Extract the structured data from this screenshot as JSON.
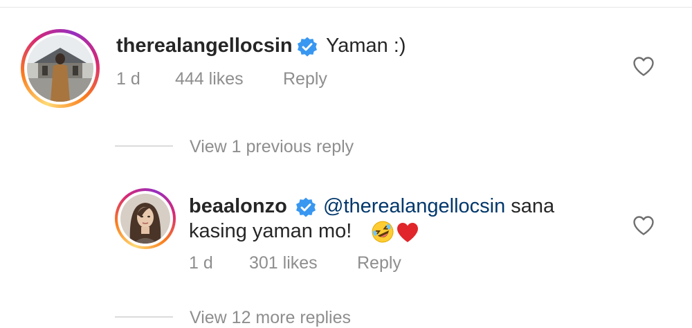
{
  "comments": [
    {
      "username": "therealangellocsin",
      "text": "Yaman :)",
      "time": "1 d",
      "likes": "444 likes",
      "reply_label": "Reply"
    },
    {
      "username": "beaalonzo",
      "mention": "@therealangellocsin",
      "text_line1": " sana",
      "text_line2": "kasing yaman mo!",
      "time": "1 d",
      "likes": "301 likes",
      "reply_label": "Reply"
    }
  ],
  "view_previous": "View 1 previous reply",
  "view_more": "View 12 more replies",
  "colors": {
    "text": "#262626",
    "secondary": "#8e8e8e",
    "mention": "#00376b",
    "verified": "#3897f0"
  },
  "icons": [
    "verified-badge-icon",
    "heart-outline-icon",
    "rolling-laughing-emoji-icon",
    "red-heart-emoji-icon"
  ]
}
